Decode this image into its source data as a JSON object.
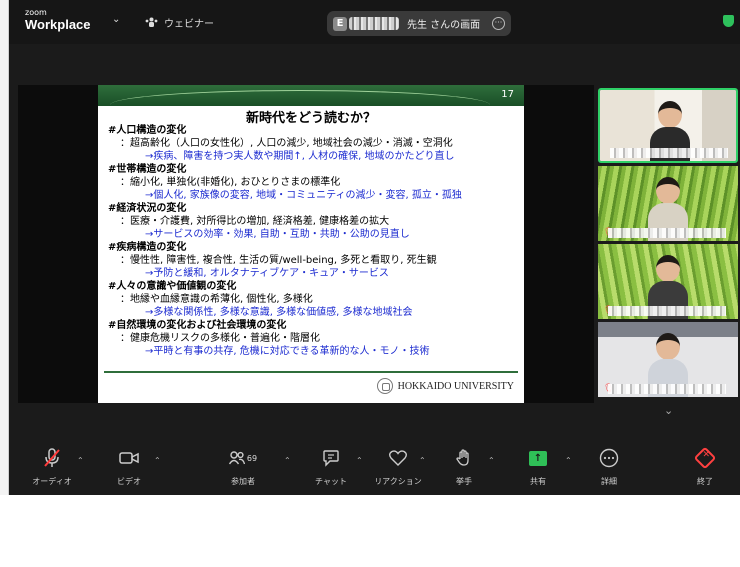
{
  "topbar": {
    "logo_small": "zoom",
    "logo_big": "Workplace",
    "webinar_label": "ウェビナー",
    "share_badge_letter": "E",
    "share_text": "先生 さんの画面"
  },
  "slide": {
    "number": "17",
    "title": "新時代をどう読むか？",
    "lines": [
      {
        "kind": "h",
        "text": "#人口構造の変化"
      },
      {
        "kind": "d",
        "text": "：超高齢化（人口の女性化）, 人口の減少, 地域社会の減少・消滅・空洞化"
      },
      {
        "kind": "b",
        "text": "→疾病、障害を持つ実人数や期間↑, 人材の確保, 地域のかたどり直し"
      },
      {
        "kind": "h",
        "text": "#世帯構造の変化"
      },
      {
        "kind": "d",
        "text": "：縮小化, 単独化(非婚化), おひとりさまの標準化"
      },
      {
        "kind": "b",
        "text": "→個人化, 家族像の変容, 地域・コミュニティの減少・変容, 孤立・孤独"
      },
      {
        "kind": "h",
        "text": "#経済状況の変化"
      },
      {
        "kind": "d",
        "text": "：医療・介護費, 対所得比の増加, 経済格差, 健康格差の拡大"
      },
      {
        "kind": "b",
        "text": "→サービスの効率・効果, 自助・互助・共助・公助の見直し"
      },
      {
        "kind": "h",
        "text": "#疾病構造の変化"
      },
      {
        "kind": "d",
        "text": "：慢性性, 障害性, 複合性, 生活の質/well-being, 多死と看取り, 死生観"
      },
      {
        "kind": "b",
        "text": "→予防と緩和, オルタナティブケア・キュア・サービス"
      },
      {
        "kind": "h",
        "text": "#人々の意識や価値観の変化"
      },
      {
        "kind": "d",
        "text": "：地縁や血縁意識の希薄化, 個性化, 多様化"
      },
      {
        "kind": "b",
        "text": "→多様な関係性, 多様な意識, 多様な価値感, 多様な地域社会"
      },
      {
        "kind": "h",
        "text": "#自然環境の変化および社会環境の変化"
      },
      {
        "kind": "d",
        "text": "：健康危機リスクの多様化・普遍化・階層化"
      },
      {
        "kind": "b",
        "text": "→平時と有事の共存, 危機に対応できる革新的な人・モノ・技術"
      }
    ],
    "footer": "HOKKAIDO UNIVERSITY"
  },
  "toolbar": {
    "audio": "オーディオ",
    "video": "ビデオ",
    "participants": "参加者",
    "participants_count": "69",
    "chat": "チャット",
    "reactions": "リアクション",
    "raise_hand": "挙手",
    "share": "共有",
    "details": "詳細",
    "end": "終了"
  }
}
